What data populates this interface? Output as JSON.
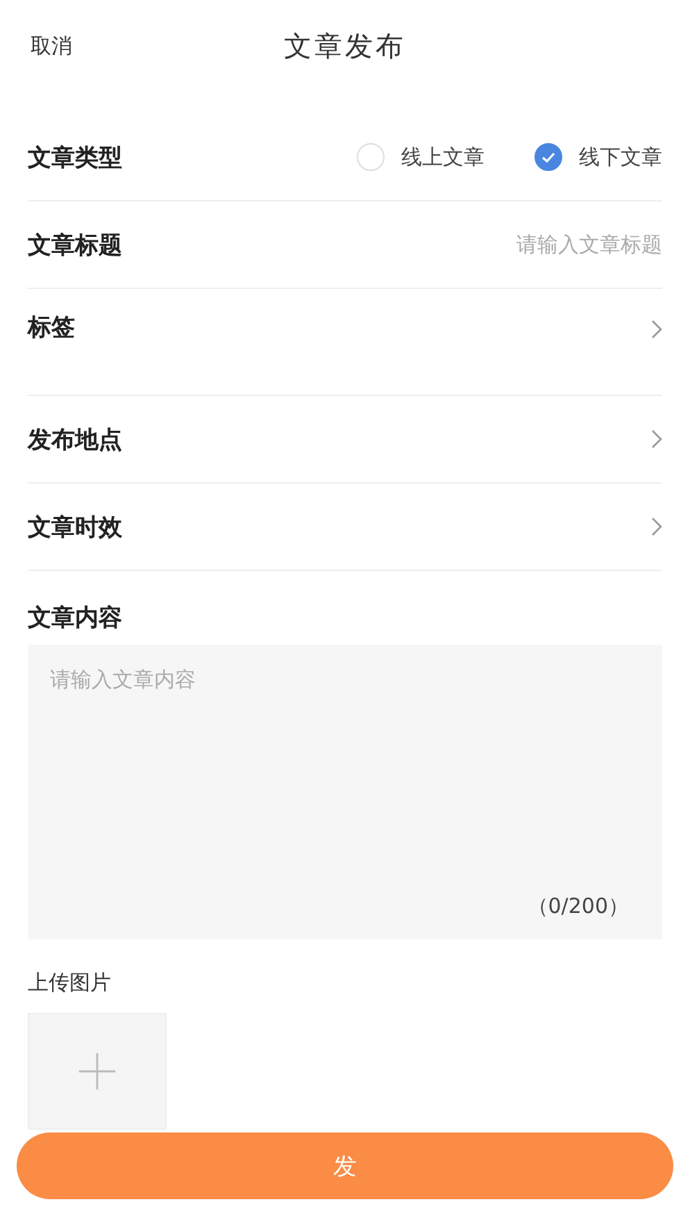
{
  "header": {
    "cancel": "取消",
    "title": "文章发布"
  },
  "type_row": {
    "label": "文章类型",
    "options": [
      {
        "label": "线上文章",
        "selected": false
      },
      {
        "label": "线下文章",
        "selected": true
      }
    ]
  },
  "title_row": {
    "label": "文章标题",
    "placeholder": "请输入文章标题"
  },
  "nav_rows": [
    {
      "label": "标签",
      "tall": true
    },
    {
      "label": "发布地点",
      "tall": false
    },
    {
      "label": "文章时效",
      "tall": false
    }
  ],
  "content": {
    "label": "文章内容",
    "placeholder": "请输入文章内容",
    "counter": "（0/200）"
  },
  "upload": {
    "label": "上传图片"
  },
  "submit": "发"
}
